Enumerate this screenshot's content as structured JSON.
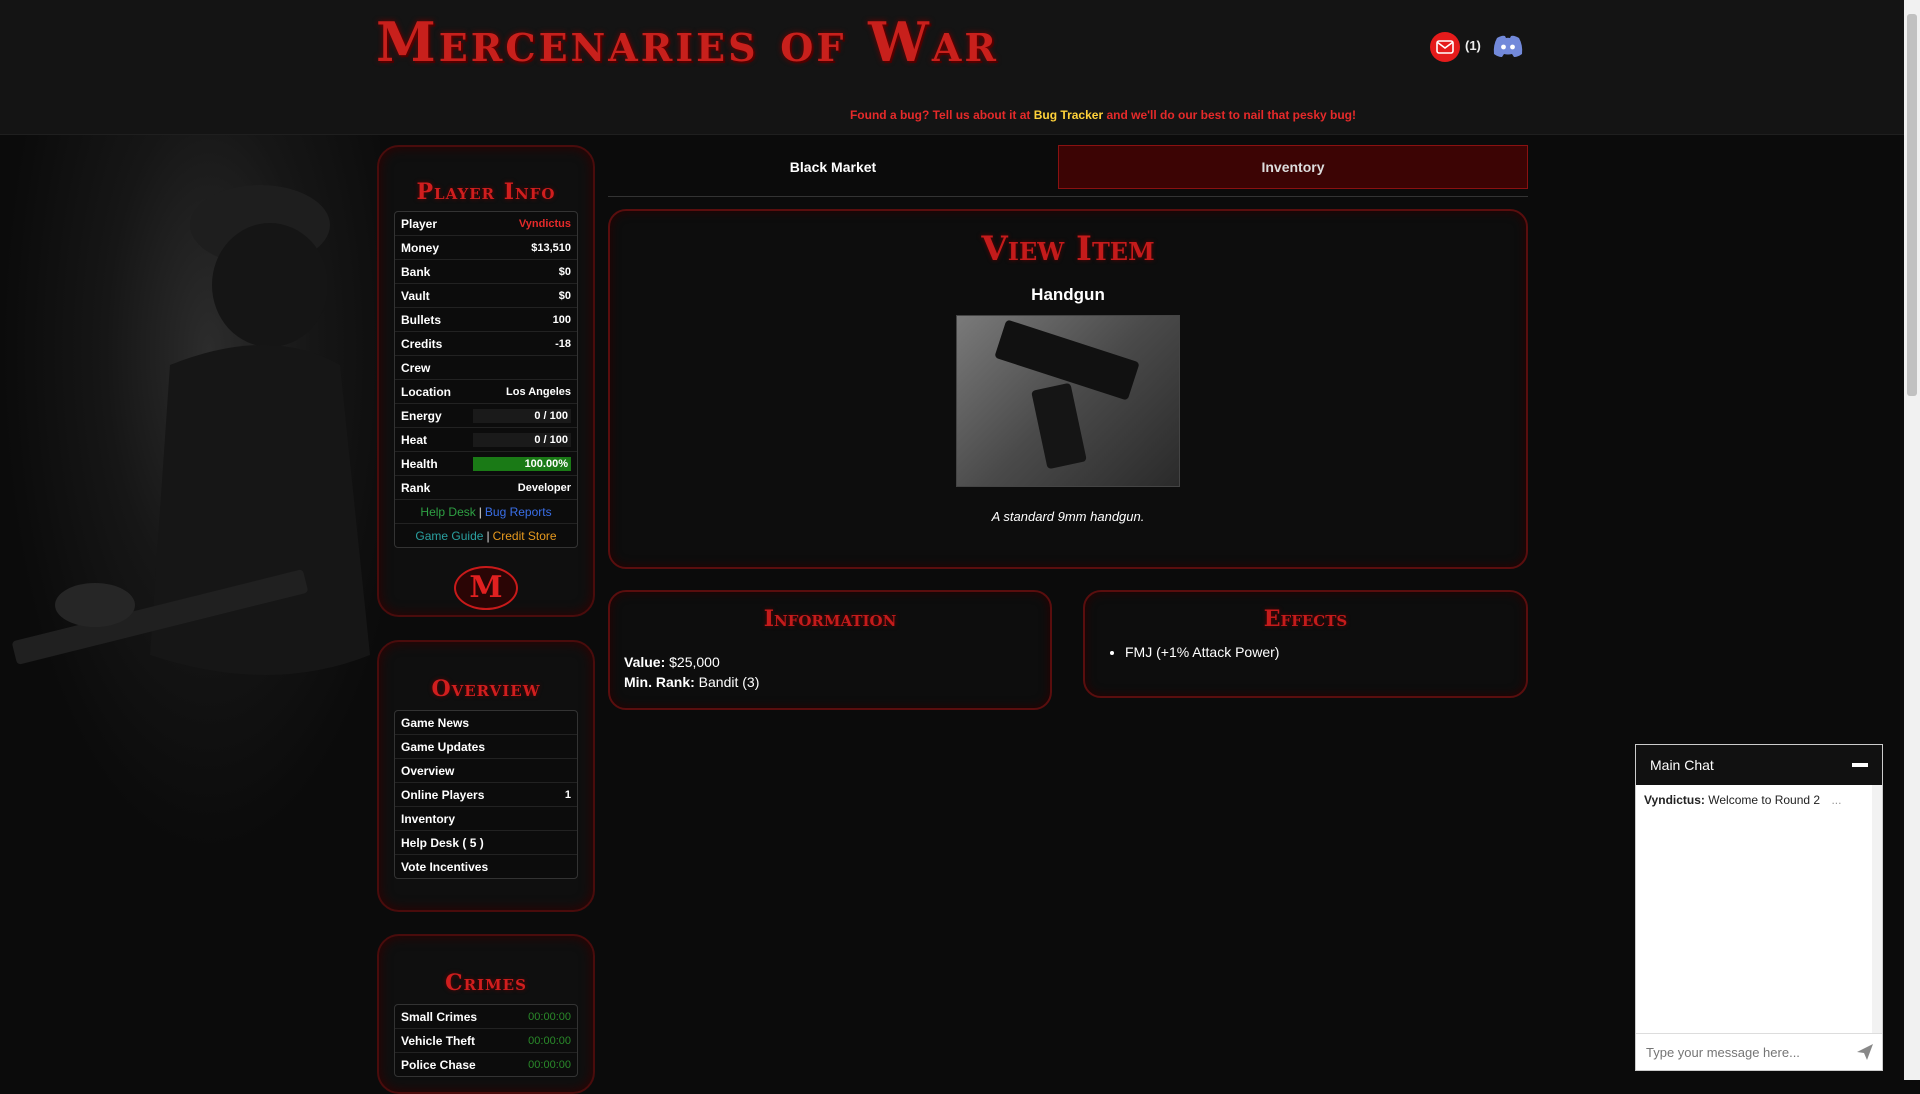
{
  "header": {
    "logo": "Mercenaries of War",
    "mail_count": "(1)",
    "bug_banner_pre": "Found a bug? Tell us about it at",
    "bug_banner_link": "Bug Tracker",
    "bug_banner_post": "and we'll do our best to nail that pesky bug!"
  },
  "player_info": {
    "title": "Player Info",
    "rows": [
      {
        "label": "Player",
        "value": "Vyndictus"
      },
      {
        "label": "Money",
        "value": "$13,510"
      },
      {
        "label": "Bank",
        "value": "$0"
      },
      {
        "label": "Vault",
        "value": "$0"
      },
      {
        "label": "Bullets",
        "value": "100"
      },
      {
        "label": "Credits",
        "value": "-18"
      },
      {
        "label": "Crew",
        "value": ""
      },
      {
        "label": "Location",
        "value": "Los Angeles"
      },
      {
        "label": "Energy",
        "value": "0 / 100"
      },
      {
        "label": "Heat",
        "value": "0 / 100"
      },
      {
        "label": "Health",
        "value": "100.00%"
      },
      {
        "label": "Rank",
        "value": "Developer"
      }
    ],
    "links1": [
      "Help Desk",
      "Bug Reports"
    ],
    "links2": [
      "Game Guide",
      "Credit Store"
    ],
    "emblem": "M"
  },
  "overview": {
    "title": "Overview",
    "items": [
      {
        "label": "Game News",
        "value": ""
      },
      {
        "label": "Game Updates",
        "value": ""
      },
      {
        "label": "Overview",
        "value": ""
      },
      {
        "label": "Online Players",
        "value": "1"
      },
      {
        "label": "Inventory",
        "value": ""
      },
      {
        "label": "Help Desk ( 5 )",
        "value": ""
      },
      {
        "label": "Vote Incentives",
        "value": ""
      }
    ]
  },
  "crimes": {
    "title": "Crimes",
    "items": [
      {
        "label": "Small Crimes",
        "value": "00:00:00"
      },
      {
        "label": "Vehicle Theft",
        "value": "00:00:00"
      },
      {
        "label": "Police Chase",
        "value": "00:00:00"
      }
    ]
  },
  "tabs": {
    "black_market": "Black Market",
    "inventory": "Inventory"
  },
  "view_item": {
    "title": "View Item",
    "name": "Handgun",
    "description": "A standard 9mm handgun."
  },
  "information": {
    "title": "Information",
    "value_label": "Value:",
    "value": "$25,000",
    "rank_label": "Min. Rank:",
    "rank": "Bandit (3)"
  },
  "effects": {
    "title": "Effects",
    "items": [
      "FMJ (+1% Attack Power)"
    ]
  },
  "chat": {
    "title": "Main Chat",
    "author": "Vyndictus:",
    "message": "Welcome to Round 2",
    "more": "...",
    "placeholder": "Type your message here..."
  },
  "colors": {
    "accent": "#c41b1b",
    "panel_border": "#5a0e0e",
    "inventory_tab": "#3c0404"
  }
}
